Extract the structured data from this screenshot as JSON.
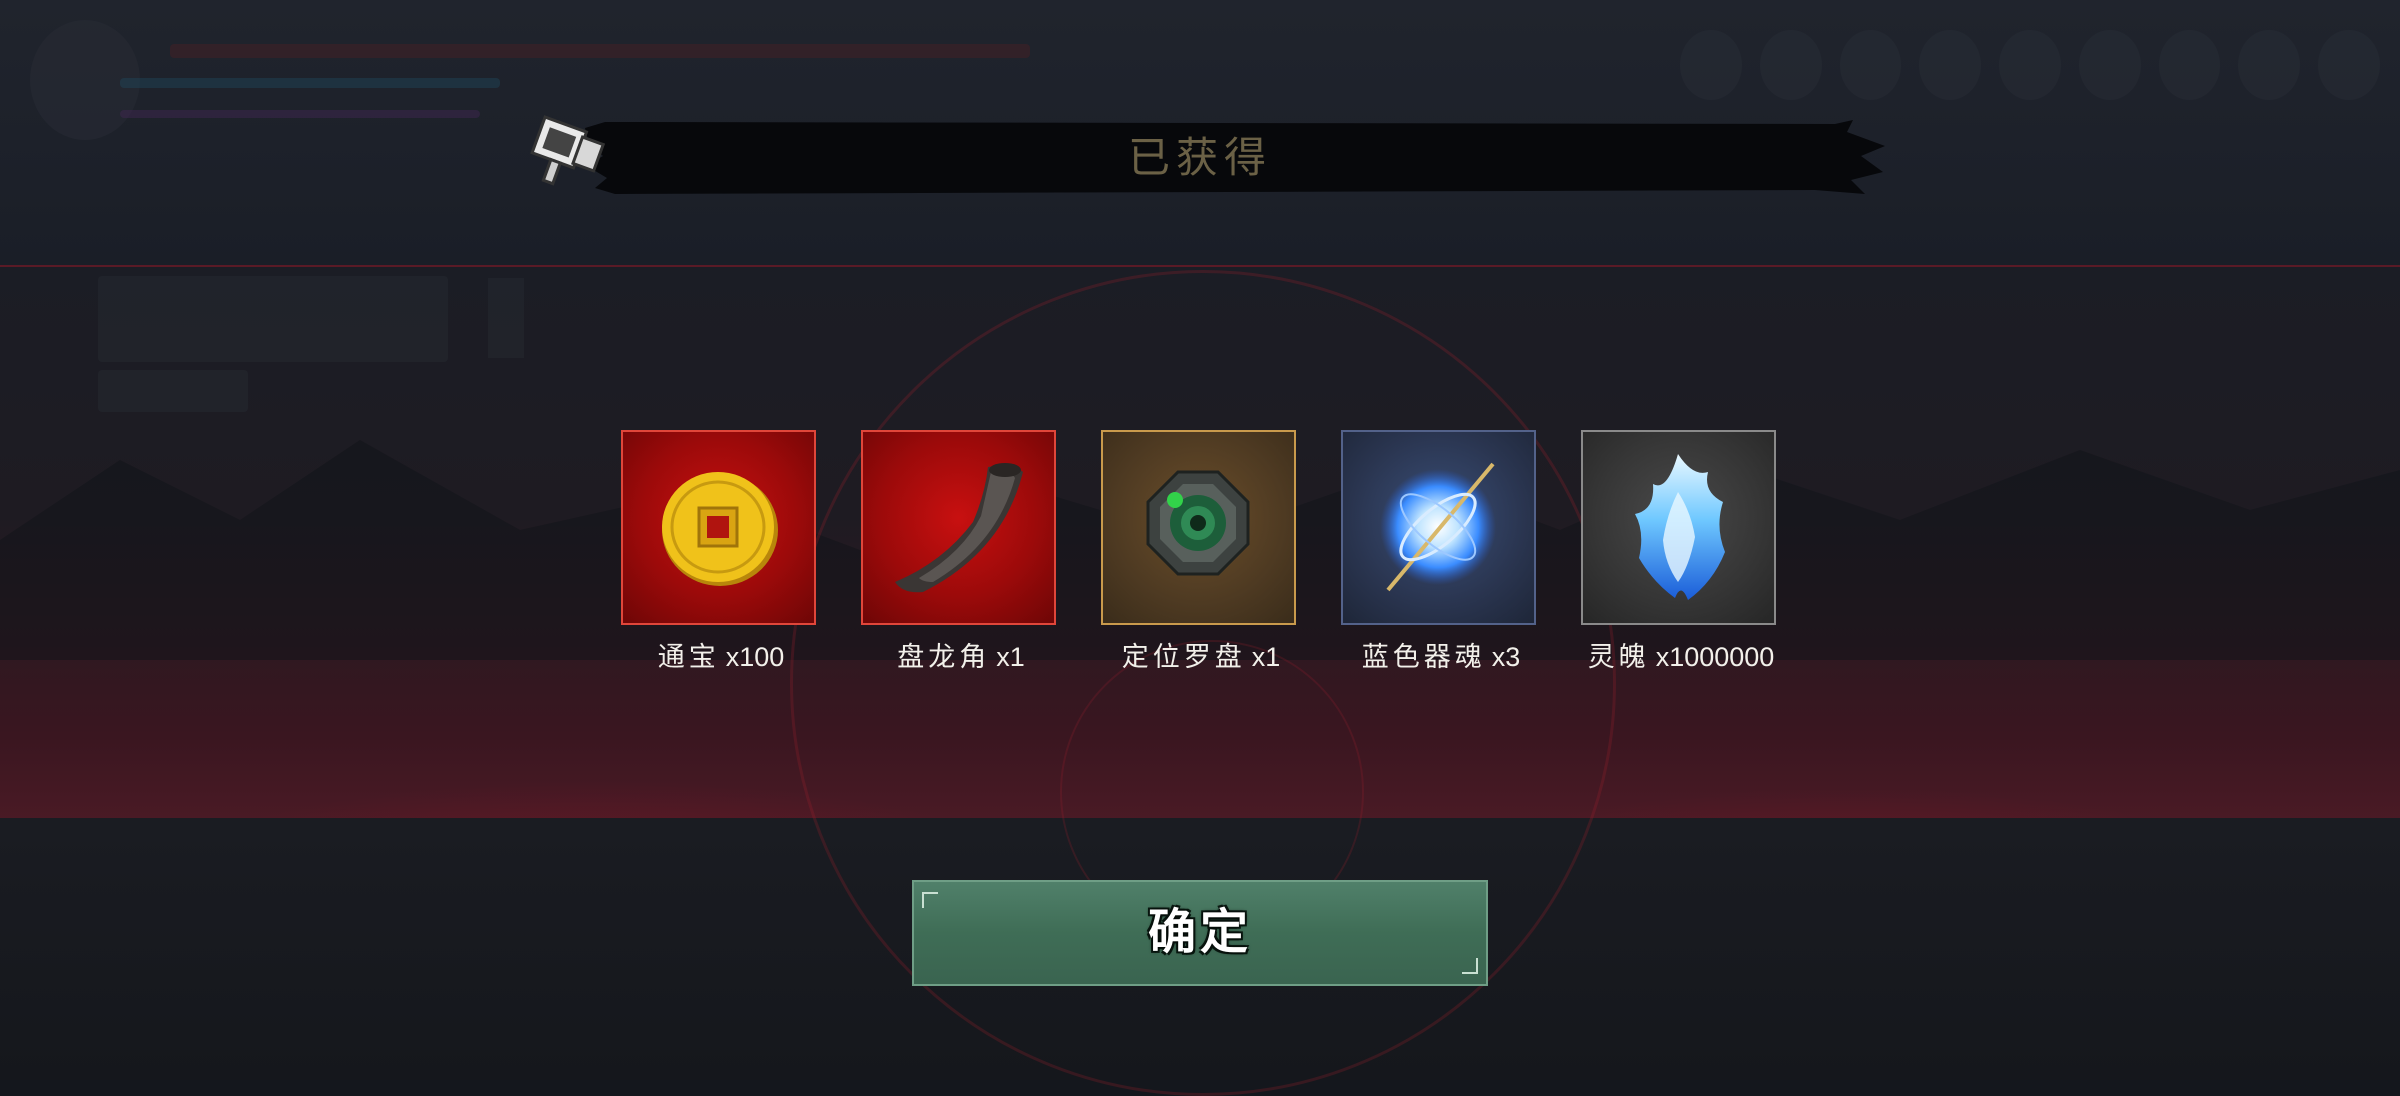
{
  "dialog": {
    "title": "已获得"
  },
  "rewards": [
    {
      "name": "通宝",
      "qty": "x100",
      "icon": "copper-coin-icon",
      "rarity": "red"
    },
    {
      "name": "盘龙角",
      "qty": "x1",
      "icon": "dragon-horn-icon",
      "rarity": "red"
    },
    {
      "name": "定位罗盘",
      "qty": "x1",
      "icon": "compass-icon",
      "rarity": "gold"
    },
    {
      "name": "蓝色器魂",
      "qty": "x3",
      "icon": "blue-soul-orb-icon",
      "rarity": "blue"
    },
    {
      "name": "灵魄",
      "qty": "x1000000",
      "icon": "spirit-flame-icon",
      "rarity": "gray"
    }
  ],
  "confirm_button": {
    "label": "确定"
  },
  "colors": {
    "rarity_red": "#c81010",
    "rarity_gold": "#c99a4c",
    "rarity_blue": "#53628a",
    "rarity_gray": "#8a8a8a",
    "confirm_green": "#3f6d56",
    "title_text": "#6b6146"
  }
}
